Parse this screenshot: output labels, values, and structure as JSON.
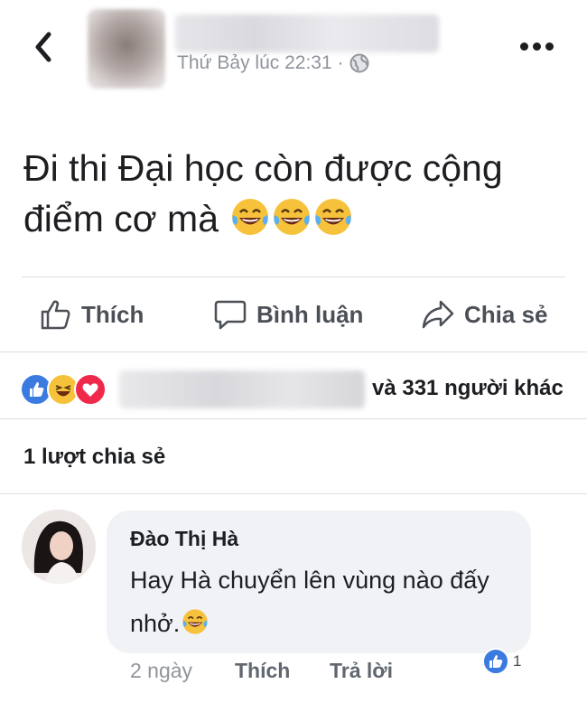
{
  "post": {
    "timestamp": "Thứ Bảy lúc 22:31 ·",
    "text": "Đi thi Đại học còn được cộng điểm cơ mà"
  },
  "icons": {
    "back": "chevron-left-icon",
    "more": "more-dots-icon",
    "privacy": "globe-icon",
    "post_emoji": "laughing-tears-emoji"
  },
  "actions": {
    "like": "Thích",
    "comment": "Bình luận",
    "share": "Chia sẻ"
  },
  "reactions": {
    "summary": "và 331 người khác",
    "types": [
      "like",
      "haha",
      "love"
    ]
  },
  "shares": {
    "text": "1 lượt chia sẻ"
  },
  "comment": {
    "author": "Đào Thị Hà",
    "text": "Hay Hà chuyển lên vùng nào đấy nhở.",
    "time": "2 ngày",
    "like_label": "Thích",
    "reply_label": "Trả lời",
    "like_count": "1"
  },
  "colors": {
    "text": "#1c1e21",
    "secondary": "#90949c",
    "action_gray": "#4b4f56",
    "like_blue": "#3b5998",
    "love_red": "#f0284a",
    "haha_yellow": "#f7c23b",
    "bubble_bg": "#f1f2f6"
  }
}
